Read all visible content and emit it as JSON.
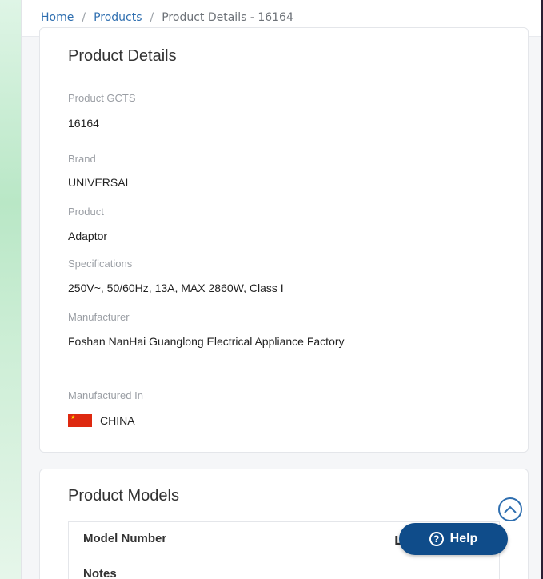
{
  "breadcrumb": {
    "home": "Home",
    "separator": "/",
    "products": "Products",
    "current": "Product Details - 16164"
  },
  "details": {
    "title": "Product Details",
    "fields": [
      {
        "label": "Product GCTS",
        "value": "16164"
      },
      {
        "label": "Brand",
        "value": "UNIVERSAL"
      },
      {
        "label": "Product",
        "value": "Adaptor"
      },
      {
        "label": "Specifications",
        "value": "250V~, 50/60Hz, 13A, MAX 2860W, Class I"
      },
      {
        "label": "Manufacturer",
        "value": "Foshan NanHai Guanglong Electrical Appliance Factory"
      },
      {
        "label": "Manufactured In",
        "value": "CHINA"
      }
    ]
  },
  "models": {
    "title": "Product Models",
    "rows": [
      "Model Number",
      "Notes"
    ],
    "obscured_letter": "L"
  },
  "help": {
    "label": "Help",
    "icon_glyph": "?"
  },
  "colors": {
    "link": "#2f6fb0",
    "help_button": "#0f4c8a",
    "flag_red": "#de2910",
    "flag_yellow": "#ffde00"
  },
  "icons": [
    "chevron-up-icon",
    "question-circle-icon",
    "china-flag-icon"
  ]
}
